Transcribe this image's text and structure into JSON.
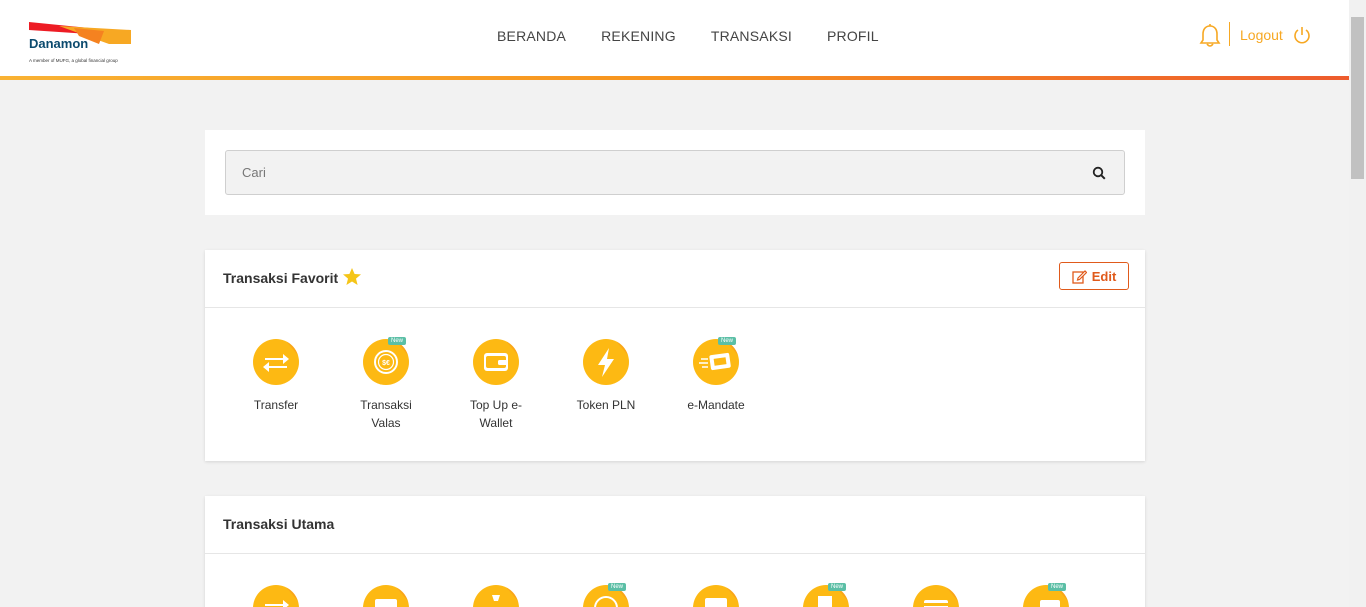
{
  "header": {
    "brand": "Danamon",
    "tagline": "A member of MUFG, a global financial group",
    "nav": [
      "BERANDA",
      "REKENING",
      "TRANSAKSI",
      "PROFIL"
    ],
    "logout_label": "Logout",
    "accent": "#f7a823"
  },
  "search": {
    "placeholder": "Cari"
  },
  "favorites": {
    "title": "Transaksi Favorit",
    "edit_label": "Edit",
    "items": [
      {
        "label": "Transfer",
        "icon": "transfer-icon",
        "badge": ""
      },
      {
        "label": "Transaksi Valas",
        "icon": "currency-exchange-icon",
        "badge": "New"
      },
      {
        "label": "Top Up e-Wallet",
        "icon": "wallet-icon",
        "badge": ""
      },
      {
        "label": "Token PLN",
        "icon": "lightning-icon",
        "badge": ""
      },
      {
        "label": "e-Mandate",
        "icon": "e-mandate-icon",
        "badge": "New"
      }
    ]
  },
  "main": {
    "title": "Transaksi Utama",
    "badges": [
      "",
      "",
      "",
      "New",
      "",
      "New",
      "",
      "New"
    ]
  },
  "colors": {
    "icon_yellow": "#fdb913",
    "icon_orange": "#f9a11b",
    "new_badge": "#5bbfa6",
    "edit_red": "#e05a1b"
  }
}
